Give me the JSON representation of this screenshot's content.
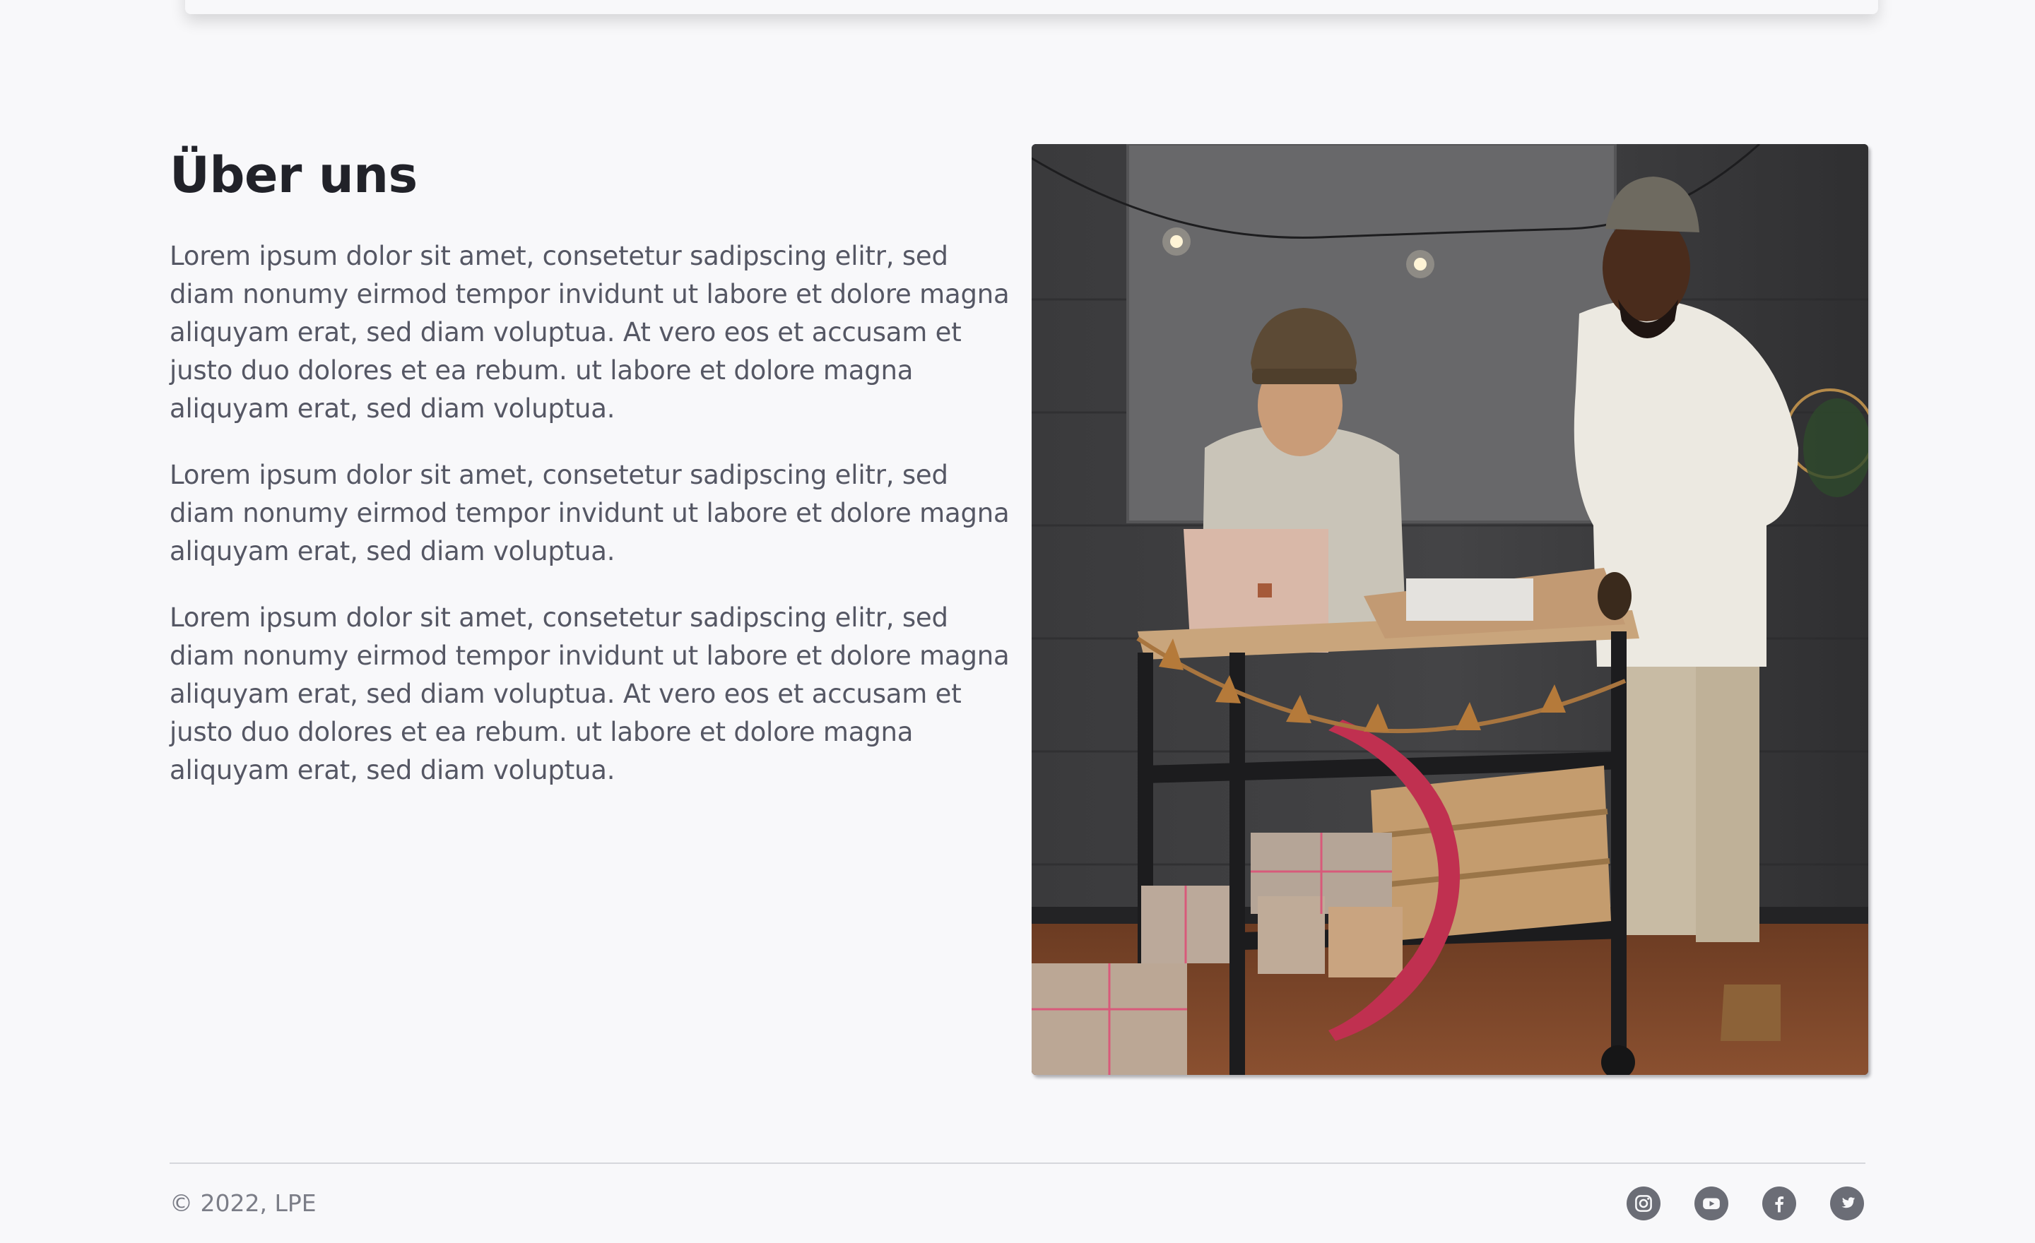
{
  "about": {
    "title": "Über uns",
    "paragraphs": [
      "Lorem ipsum dolor sit amet, consetetur sadipscing elitr, sed diam nonumy eirmod tempor invidunt ut labore et dolore magna aliquyam erat, sed diam voluptua. At vero eos et accusam et justo duo dolores et ea rebum. ut labore et dolore magna aliquyam erat, sed diam voluptua.",
      "Lorem ipsum dolor sit amet, consetetur sadipscing elitr, sed diam nonumy eirmod tempor invidunt ut labore et dolore magna aliquyam erat, sed diam voluptua.",
      "Lorem ipsum dolor sit amet, consetetur sadipscing elitr, sed diam nonumy eirmod tempor invidunt ut labore et dolore magna aliquyam erat, sed diam voluptua. At vero eos et accusam et justo duo dolores et ea rebum. ut labore et dolore magna aliquyam erat, sed diam voluptua."
    ]
  },
  "footer": {
    "copyright": "© 2022, LPE",
    "social": [
      {
        "icon": "instagram-icon"
      },
      {
        "icon": "youtube-icon"
      },
      {
        "icon": "facebook-icon"
      },
      {
        "icon": "twitter-icon"
      }
    ]
  },
  "colors": {
    "background": "#f8f8fa",
    "heading": "#212229",
    "body_text": "#555764",
    "muted_text": "#7b7d87",
    "icon_bg": "#6b6d76"
  }
}
